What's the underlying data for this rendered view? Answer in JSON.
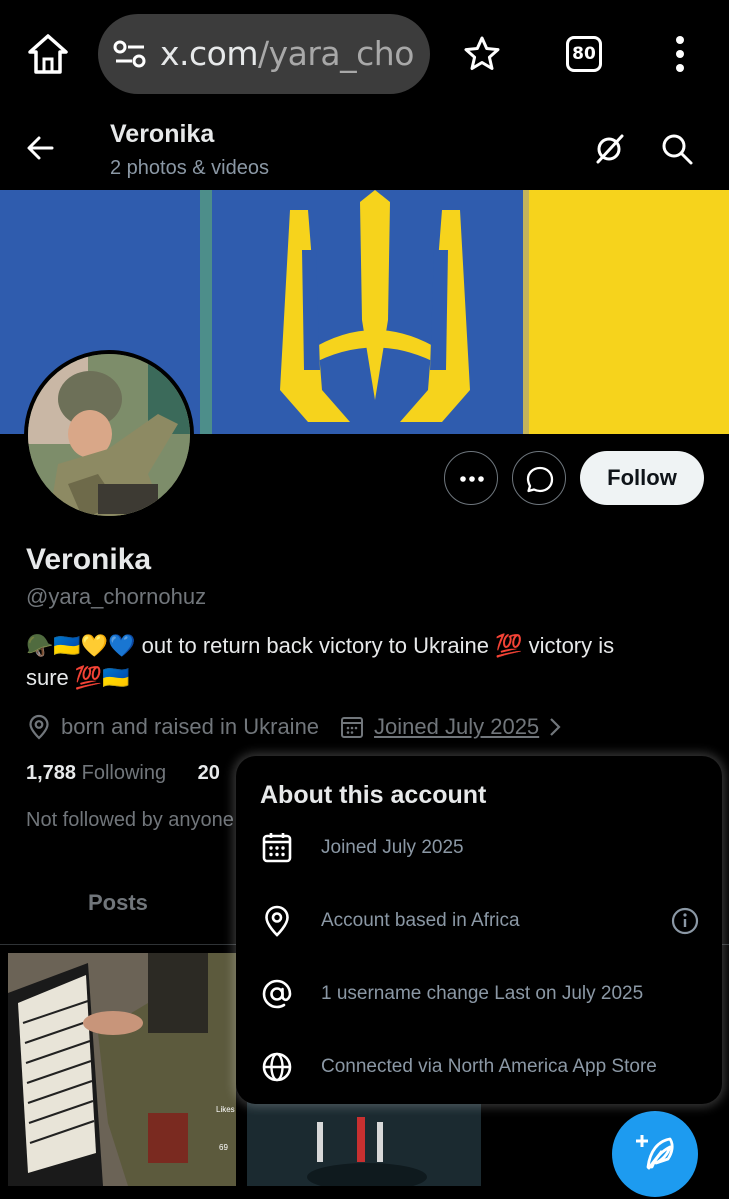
{
  "browser": {
    "url_host": "x.com",
    "url_path": "/yara_cho",
    "tab_count": "80"
  },
  "header": {
    "title": "Veronika",
    "subtitle": "2 photos & videos"
  },
  "profile": {
    "display_name": "Veronika",
    "handle": "@yara_chornohuz",
    "follow_label": "Follow",
    "bio_line1": "🪖🇺🇦💛💙 out to return back victory to Ukraine 💯 victory is",
    "bio_line2": "sure 💯🇺🇦",
    "location": "born and raised in Ukraine",
    "joined": "Joined July 2025",
    "following_count": "1,788",
    "following_label": "Following",
    "followers_count": "20",
    "not_followed": "Not followed by anyone"
  },
  "tabs": {
    "posts": "Posts"
  },
  "media": {
    "likes_label": "Likes",
    "comment_count": "69"
  },
  "about": {
    "title": "About this account",
    "rows": [
      {
        "icon": "calendar-icon",
        "text": "Joined July 2025"
      },
      {
        "icon": "location-pin-icon",
        "text": "Account based in Africa"
      },
      {
        "icon": "at-sign-icon",
        "text": "1 username change Last on July 2025"
      },
      {
        "icon": "globe-icon",
        "text": "Connected via North America App Store"
      }
    ]
  },
  "colors": {
    "background": "#000000",
    "accent": "#1d9bf0",
    "follow_button": "#eff3f4",
    "muted_text": "#71767b"
  }
}
